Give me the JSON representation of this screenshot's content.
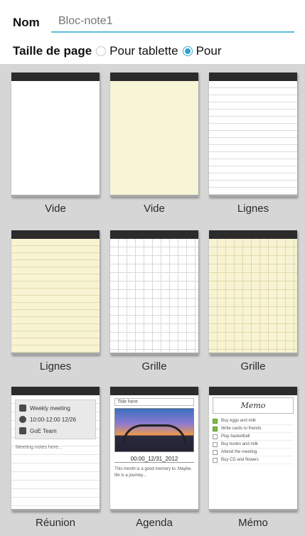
{
  "header": {
    "name_label": "Nom",
    "name_placeholder": "Bloc-note1",
    "size_label": "Taille de page",
    "options": [
      {
        "label": "Pour tablette",
        "selected": false
      },
      {
        "label": "Pour",
        "selected": true
      }
    ]
  },
  "templates": [
    {
      "label": "Vide",
      "style": "blank"
    },
    {
      "label": "Vide",
      "style": "yellow"
    },
    {
      "label": "Lignes",
      "style": "lines"
    },
    {
      "label": "Lignes",
      "style": "yellow-lines"
    },
    {
      "label": "Grille",
      "style": "grid"
    },
    {
      "label": "Grille",
      "style": "yellow-grid"
    },
    {
      "label": "Réunion",
      "style": "meeting"
    },
    {
      "label": "Agenda",
      "style": "agenda"
    },
    {
      "label": "Mémo",
      "style": "memo"
    }
  ],
  "meeting": {
    "rows": [
      "Weekly meeting",
      "10:00-12:00 12/26",
      "GoE Team"
    ],
    "notes": "Meeting notes here..."
  },
  "agenda": {
    "title": "Title here",
    "date": "00:00_12/31_2012",
    "text": "This month is a good memory to. Maybe, life is a journey..."
  },
  "memo": {
    "title": "Memo",
    "items": [
      {
        "text": "Buy eggs and milk",
        "checked": true
      },
      {
        "text": "Write cards to friends",
        "checked": true
      },
      {
        "text": "Play basketball",
        "checked": false
      },
      {
        "text": "Buy books and milk",
        "checked": false
      },
      {
        "text": "Attend the meeting",
        "checked": false
      },
      {
        "text": "Buy CD and flowers",
        "checked": false
      }
    ]
  },
  "colors": {
    "accent": "#2f9fd0",
    "input_underline": "#58c0d8",
    "grid_background": "#d6d6d6",
    "card_topbar": "#2b2b2b",
    "yellow_paper": "#f8f4d6"
  }
}
